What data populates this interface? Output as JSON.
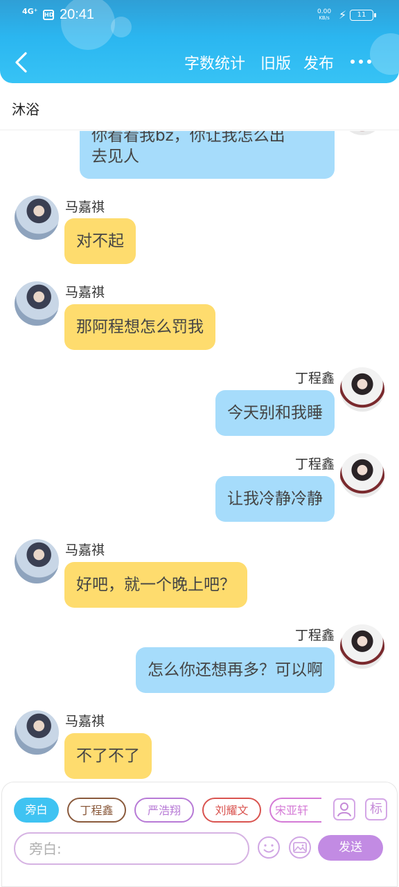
{
  "status_bar": {
    "signal": "4G⁺",
    "hd": "HD",
    "time": "20:41",
    "speed_value": "0.00",
    "speed_unit": "KB/s",
    "battery": "11"
  },
  "header": {
    "actions": [
      "字数统计",
      "旧版",
      "发布"
    ]
  },
  "title": "沐浴",
  "messages": [
    {
      "side": "right",
      "sender": "",
      "text": "你看看我bz，你让我怎么出去见人",
      "partial": true
    },
    {
      "side": "left",
      "sender": "马嘉祺",
      "text": "对不起"
    },
    {
      "side": "left",
      "sender": "马嘉祺",
      "text": "那阿程想怎么罚我"
    },
    {
      "side": "right",
      "sender": "丁程鑫",
      "text": "今天别和我睡"
    },
    {
      "side": "right",
      "sender": "丁程鑫",
      "text": "让我冷静冷静"
    },
    {
      "side": "left",
      "sender": "马嘉祺",
      "text": "好吧，就一个晚上吧？"
    },
    {
      "side": "right",
      "sender": "丁程鑫",
      "text": "怎么你还想再多？可以啊"
    },
    {
      "side": "left",
      "sender": "马嘉祺",
      "text": "不了不了"
    }
  ],
  "partial_lines": [
    "你看看我bz，你让我怎么出",
    "去见人"
  ],
  "characters": [
    "旁白",
    "丁程鑫",
    "严浩翔",
    "刘耀文",
    "宋亚轩"
  ],
  "chip_colors": [
    "#3fc3f2",
    "#8a5a3c",
    "#b77ad6",
    "#d9534f",
    "#d47ad6"
  ],
  "tools": {
    "avatar_icon": "person-icon",
    "mark_label": "标"
  },
  "input": {
    "placeholder": "旁白:",
    "value": ""
  },
  "send_label": "发送",
  "colors": {
    "header": "#2bb6f0",
    "left_bubble": "#fedc6e",
    "right_bubble": "#a6dcfb",
    "send_button": "#c28be3"
  }
}
